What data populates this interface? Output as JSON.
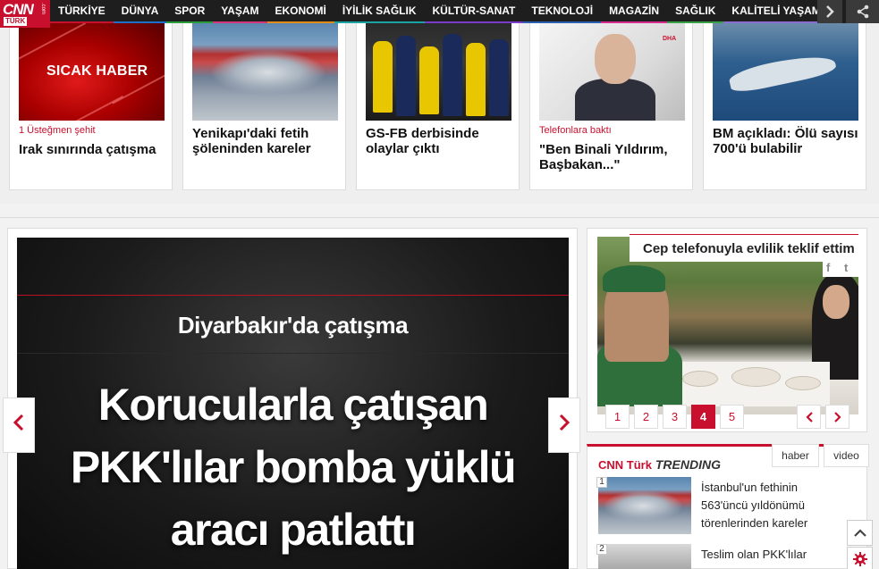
{
  "brand": {
    "logo_main": "CNN",
    "logo_sub": "TÜRK",
    "logo_com": ".com"
  },
  "nav": {
    "items": [
      {
        "label": "TÜRKİYE",
        "color": "#c8102e"
      },
      {
        "label": "DÜNYA",
        "color": "#1e6fc8"
      },
      {
        "label": "SPOR",
        "color": "#2a9d3a"
      },
      {
        "label": "YAŞAM",
        "color": "#d4357a"
      },
      {
        "label": "EKONOMİ",
        "color": "#e08a1a"
      },
      {
        "label": "İYİLİK SAĞLIK",
        "color": "#1aa3a3"
      },
      {
        "label": "KÜLTÜR-SANAT",
        "color": "#7a3bc8"
      },
      {
        "label": "TEKNOLOJİ",
        "color": "#2c5fb0"
      },
      {
        "label": "MAGAZİN",
        "color": "#d42b8c"
      },
      {
        "label": "SAĞLIK",
        "color": "#3aa047"
      },
      {
        "label": "KALİTELİ YAŞAM",
        "color": "#8a6bd0"
      }
    ],
    "more_icon": "chevron-right-icon",
    "share_icon": "share-icon"
  },
  "top_cards": [
    {
      "thumb_label": "SICAK HABER",
      "kicker": "1 Üsteğmen şehit",
      "title": "Irak sınırında çatışma"
    },
    {
      "thumb_label": "",
      "kicker": "",
      "title": "Yenikapı'daki fetih şöleninden kareler"
    },
    {
      "thumb_label": "",
      "kicker": "",
      "title": "GS-FB derbisinde olaylar çıktı"
    },
    {
      "thumb_label": "DHA",
      "kicker": "Telefonlara baktı",
      "title": "\"Ben Binali Yıldırım, Başbakan...\""
    },
    {
      "thumb_label": "",
      "kicker": "",
      "title": "BM açıkladı: Ölü sayısı 700'ü bulabilir"
    }
  ],
  "slider": {
    "subtitle": "Diyarbakır'da çatışma",
    "headline_lines": [
      "Korucularla çatışan",
      "PKK'lılar bomba yüklü",
      "aracı patlattı"
    ],
    "prev_icon": "chevron-left-icon",
    "next_icon": "chevron-right-icon"
  },
  "gallery": {
    "title": "Cep telefonuyla evlilik teklif ettim",
    "social": [
      "f",
      "t"
    ],
    "pages": [
      "1",
      "2",
      "3",
      "4",
      "5"
    ],
    "active_page": "4",
    "prev_label": "‹",
    "next_label": "›"
  },
  "trending": {
    "brand": "CNN Türk",
    "label": "TRENDING",
    "tabs": [
      "haber",
      "video"
    ],
    "items": [
      {
        "num": "1",
        "text": "İstanbul'un fethinin 563'üncü yıldönümü törenlerinden kareler"
      },
      {
        "num": "2",
        "text": "Teslim olan PKK'lılar"
      }
    ]
  },
  "floating": {
    "top_icon": "chevron-up-icon",
    "settings_icon": "gear-icon"
  },
  "colors": {
    "accent": "#c8102e",
    "navbar": "#1e1e1e"
  }
}
